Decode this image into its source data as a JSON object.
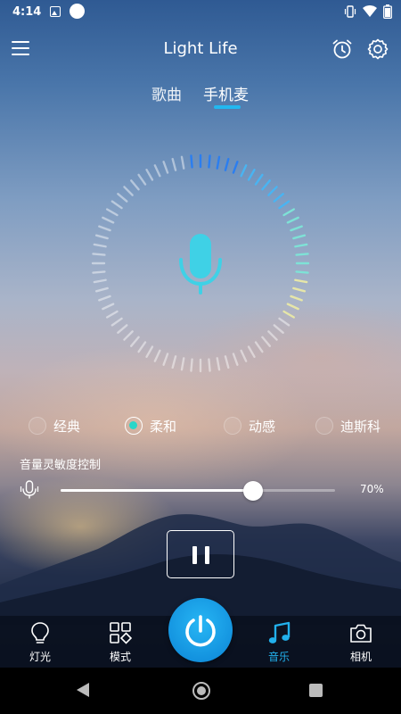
{
  "status_bar": {
    "time": "4:14",
    "left_icons": [
      "image-icon",
      "circle-dot-icon"
    ],
    "right_icons": [
      "vibrate-icon",
      "wifi-icon",
      "battery-icon"
    ]
  },
  "header": {
    "title": "Light Life",
    "icons": [
      "menu-icon",
      "alarm-icon",
      "settings-icon"
    ]
  },
  "tabs": [
    {
      "label": "歌曲",
      "active": false
    },
    {
      "label": "手机麦",
      "active": true
    }
  ],
  "mic": {
    "icon": "microphone-icon",
    "accent_color": "#3fd1e6"
  },
  "modes": [
    {
      "label": "经典",
      "selected": false
    },
    {
      "label": "柔和",
      "selected": true
    },
    {
      "label": "动感",
      "selected": false
    },
    {
      "label": "迪斯科",
      "selected": false
    }
  ],
  "sensitivity": {
    "title": "音量灵敏度控制",
    "value_text": "70%",
    "level": 0.7
  },
  "playback": {
    "icon": "pause-icon"
  },
  "bottom_nav": {
    "items": [
      {
        "label": "灯光",
        "icon": "bulb-icon",
        "active": false
      },
      {
        "label": "模式",
        "icon": "grid-diamond-icon",
        "active": false
      },
      {
        "label": "音乐",
        "icon": "music-note-icon",
        "active": true
      },
      {
        "label": "相机",
        "icon": "camera-icon",
        "active": false
      }
    ],
    "power_icon": "power-icon",
    "accent_color": "#22b0ec"
  },
  "system_nav": {
    "icons": [
      "back-icon",
      "home-icon",
      "recents-icon"
    ]
  }
}
